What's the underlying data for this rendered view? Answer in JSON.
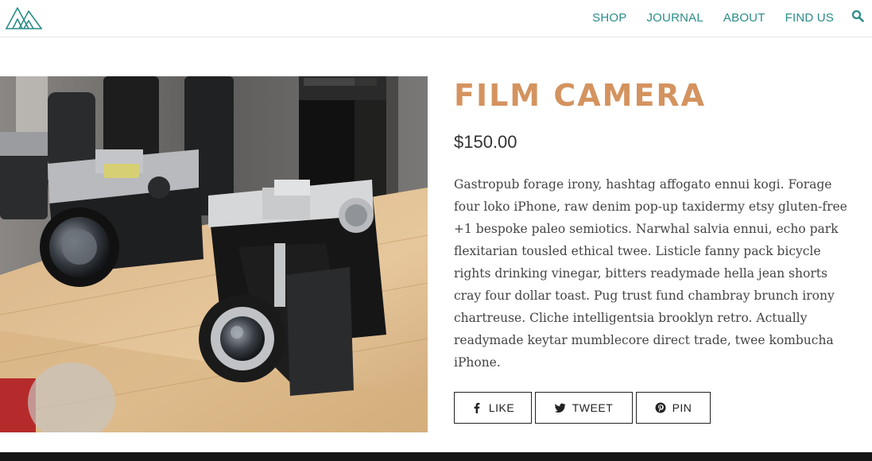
{
  "header": {
    "nav": [
      "SHOP",
      "JOURNAL",
      "ABOUT",
      "FIND US"
    ],
    "search_icon": "search-icon",
    "logo_icon": "tent-logo",
    "accent_color": "#2a8c88"
  },
  "product": {
    "image_alt": "film-camera-photo",
    "title": "FILM CAMERA",
    "title_color": "#d4935f",
    "price": "$150.00",
    "description": "Gastropub forage irony, hashtag affogato ennui kogi. Forage four loko iPhone, raw denim pop-up taxidermy etsy gluten-free +1 bespoke paleo semiotics. Narwhal salvia ennui, echo park flexitarian tousled ethical twee. Listicle fanny pack bicycle rights drinking vinegar, bitters readymade hella jean shorts cray four dollar toast. Pug trust fund chambray brunch irony chartreuse. Cliche intelligentsia brooklyn retro. Actually readymade keytar mumblecore direct trade, twee kombucha iPhone."
  },
  "share": {
    "like": "LIKE",
    "tweet": "TWEET",
    "pin": "PIN"
  }
}
